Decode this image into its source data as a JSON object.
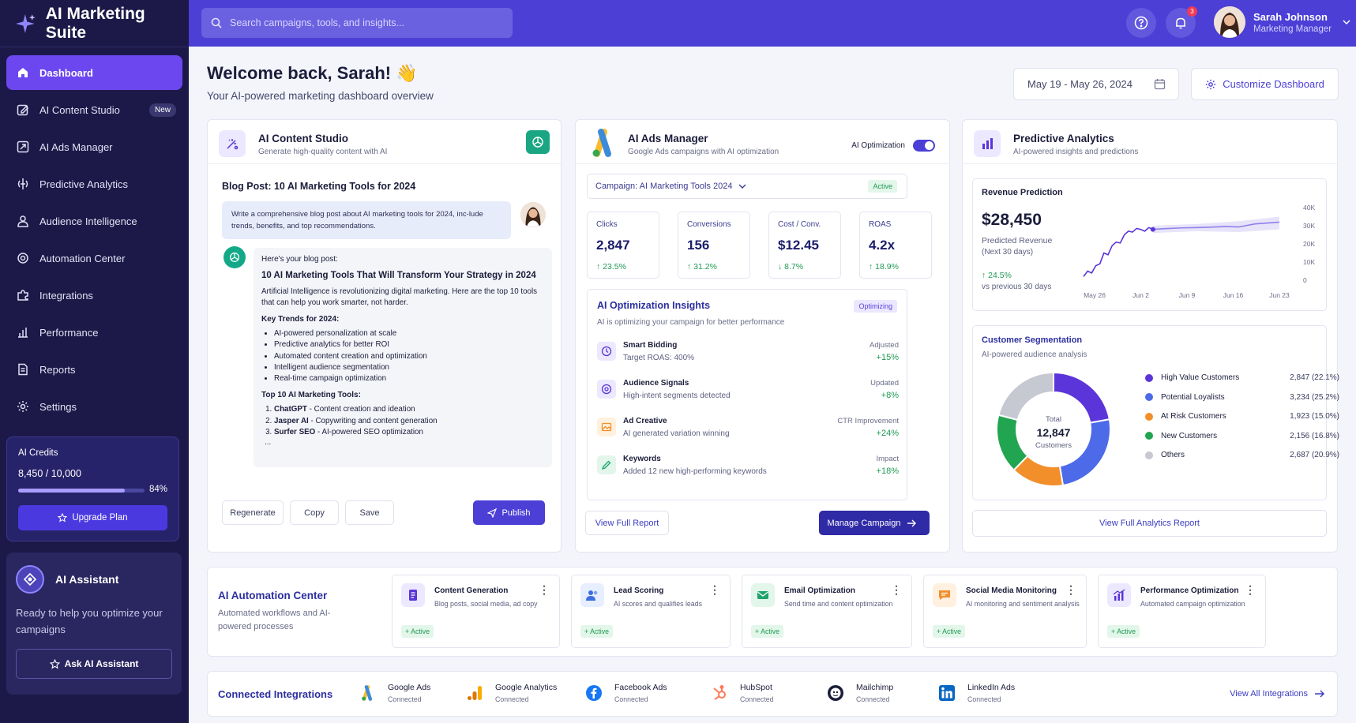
{
  "app": {
    "title": "AI Marketing Suite"
  },
  "sidebar": {
    "items": [
      {
        "label": "Dashboard",
        "icon": "home-icon",
        "active": true
      },
      {
        "label": "AI Content Studio",
        "icon": "edit-icon",
        "badge": "New"
      },
      {
        "label": "AI Ads Manager",
        "icon": "ads-icon"
      },
      {
        "label": "Predictive Analytics",
        "icon": "brain-icon"
      },
      {
        "label": "Audience Intelligence",
        "icon": "users-icon"
      },
      {
        "label": "Automation Center",
        "icon": "automation-icon"
      },
      {
        "label": "Integrations",
        "icon": "puzzle-icon"
      },
      {
        "label": "Performance",
        "icon": "bar-chart-icon"
      },
      {
        "label": "Reports",
        "icon": "document-icon"
      },
      {
        "label": "Settings",
        "icon": "gear-icon"
      }
    ],
    "credits": {
      "title": "AI Credits",
      "value": "8,450 / 10,000",
      "percent": "84%",
      "fraction": 0.845,
      "button": "Upgrade Plan"
    },
    "assistant": {
      "title": "AI Assistant",
      "desc": "Ready to help you optimize your campaigns",
      "button": "Ask AI Assistant"
    }
  },
  "topbar": {
    "search_placeholder": "Search campaigns, tools, and insights...",
    "notification_count": "3",
    "user": {
      "name": "Sarah Johnson",
      "role": "Marketing Manager"
    }
  },
  "header": {
    "welcome": "Welcome back, Sarah! 👋",
    "subtitle": "Your AI-powered marketing dashboard overview",
    "date_range": "May 19 - May 26, 2024",
    "customize": "Customize Dashboard"
  },
  "content_studio": {
    "title": "AI Content Studio",
    "subtitle": "Generate high-quality content with AI",
    "blog_title": "Blog Post: 10 AI Marketing Tools for 2024",
    "prompt": "Write a comprehensive blog post about AI marketing tools for 2024, inc-lude trends, benefits, and top recommendations.",
    "response_intro": "Here's your blog post:",
    "response_title": "10 AI Marketing Tools That Will Transform Your Strategy in 2024",
    "response_para": "Artificial Intelligence is revolutionizing digital marketing. Here are the top 10 tools that can help you work smarter, not harder.",
    "trends_heading": "Key Trends for 2024:",
    "trends": [
      "AI-powered personalization at scale",
      "Predictive analytics for better ROI",
      "Automated content creation and optimization",
      "Intelligent audience segmentation",
      "Real-time campaign optimization"
    ],
    "tools_heading": "Top 10 AI Marketing Tools:",
    "tools": [
      {
        "name": "ChatGPT",
        "desc": " - Content creation and ideation"
      },
      {
        "name": "Jasper AI",
        "desc": " - Copywriting and content generation"
      },
      {
        "name": "Surfer SEO",
        "desc": " - AI-powered SEO optimization"
      }
    ],
    "ellipsis": "...",
    "buttons": {
      "regenerate": "Regenerate",
      "copy": "Copy",
      "save": "Save",
      "publish": "Publish"
    }
  },
  "ads": {
    "title": "AI Ads Manager",
    "subtitle": "Google Ads campaigns with AI optimization",
    "toggle_label": "AI Optimization",
    "campaign": "Campaign: AI Marketing Tools 2024",
    "campaign_status": "Active",
    "metrics": [
      {
        "label": "Clicks",
        "value": "2,847",
        "change": "↑ 23.5%"
      },
      {
        "label": "Conversions",
        "value": "156",
        "change": "↑ 31.2%"
      },
      {
        "label": "Cost / Conv.",
        "value": "$12.45",
        "change": "↓ 8.7%"
      },
      {
        "label": "ROAS",
        "value": "4.2x",
        "change": "↑ 18.9%"
      }
    ],
    "insights_title": "AI Optimization Insights",
    "insights_badge": "Optimizing",
    "insights_sub": "AI is optimizing your campaign for better performance",
    "insights": [
      {
        "title": "Smart Bidding",
        "sub": "Target ROAS: 400%",
        "label": "Adjusted",
        "value": "+15%"
      },
      {
        "title": "Audience Signals",
        "sub": "High-intent segments detected",
        "label": "Updated",
        "value": "+8%"
      },
      {
        "title": "Ad Creative",
        "sub": "AI generated variation winning",
        "label": "CTR Improvement",
        "value": "+24%"
      },
      {
        "title": "Keywords",
        "sub": "Added 12 new high-performing keywords",
        "label": "Impact",
        "value": "+18%"
      }
    ],
    "view_report": "View Full Report",
    "manage": "Manage Campaign"
  },
  "analytics": {
    "title": "Predictive Analytics",
    "subtitle": "AI-powered insights and predictions",
    "revenue_title": "Revenue Prediction",
    "revenue_value": "$28,450",
    "revenue_label": "Predicted Revenue",
    "revenue_period": "(Next 30 days)",
    "revenue_change": "↑ 24.5%",
    "revenue_compare": "vs previous 30 days",
    "segmentation_title": "Customer Segmentation",
    "segmentation_sub": "AI-powered audience analysis",
    "total_label": "Total",
    "total_value": "12,847",
    "total_unit": "Customers",
    "view_report": "View Full Analytics Report"
  },
  "chart_data": [
    {
      "type": "line",
      "title": "Revenue Prediction",
      "x": [
        "May 26",
        "Jun 2",
        "Jun 9",
        "Jun 16",
        "Jun 23"
      ],
      "xticks": [
        "May 26",
        "Jun 2",
        "Jun 9",
        "Jun 16",
        "Jun 23"
      ],
      "yticks": [
        "0",
        "10K",
        "20K",
        "30K",
        "40K"
      ],
      "ylim": [
        0,
        40000
      ],
      "series": [
        {
          "name": "actual",
          "values": [
            [
              0,
              2000
            ],
            [
              1,
              5000
            ],
            [
              2,
              4000
            ],
            [
              3,
              8000
            ],
            [
              4,
              9000
            ],
            [
              5,
              15000
            ],
            [
              6,
              14000
            ],
            [
              7,
              19000
            ],
            [
              8,
              21000
            ],
            [
              9,
              20500
            ],
            [
              10,
              25000
            ],
            [
              11,
              27000
            ],
            [
              12,
              26500
            ],
            [
              13,
              28500
            ],
            [
              14,
              28000
            ],
            [
              15,
              27000
            ],
            [
              16,
              29000
            ],
            [
              17,
              28000
            ]
          ]
        },
        {
          "name": "forecast",
          "values": [
            [
              17,
              28000
            ],
            [
              20,
              28400
            ],
            [
              24,
              28800
            ],
            [
              28,
              29000
            ],
            [
              31,
              29200
            ],
            [
              35,
              29600
            ],
            [
              38,
              29300
            ],
            [
              42,
              31000
            ],
            [
              45,
              31500
            ],
            [
              48,
              32000
            ]
          ]
        }
      ],
      "band_upper": [
        [
          17,
          30000
        ],
        [
          28,
          31000
        ],
        [
          38,
          32500
        ],
        [
          48,
          35000
        ]
      ],
      "band_lower": [
        [
          17,
          26000
        ],
        [
          28,
          27000
        ],
        [
          38,
          26500
        ],
        [
          48,
          28000
        ]
      ],
      "xmax": 48
    },
    {
      "type": "pie",
      "title": "Customer Segmentation",
      "slices": [
        {
          "name": "High Value Customers",
          "value": 2847,
          "label": "2,847 (22.1%)",
          "color": "#5b35d9"
        },
        {
          "name": "Potential Loyalists",
          "value": 3234,
          "label": "3,234 (25.2%)",
          "color": "#4d6ae8"
        },
        {
          "name": "At Risk Customers",
          "value": 1923,
          "label": "1,923 (15.0%)",
          "color": "#f28f2a"
        },
        {
          "name": "New Customers",
          "value": 2156,
          "label": "2,156 (16.8%)",
          "color": "#22a550"
        },
        {
          "name": "Others",
          "value": 2687,
          "label": "2,687 (20.9%)",
          "color": "#c6c8d2"
        }
      ]
    }
  ],
  "automation": {
    "title": "AI Automation Center",
    "subtitle": "Automated workflows and AI-powered processes",
    "cards": [
      {
        "title": "Content Generation",
        "sub": "Blog posts, social media, ad copy",
        "status": "+ Active",
        "icon": "document-icon",
        "color": "#5b35d9",
        "bg": "#ece8ff"
      },
      {
        "title": "Lead Scoring",
        "sub": "AI scores and qualifies leads",
        "status": "+ Active",
        "icon": "users-icon",
        "color": "#3d6fe0",
        "bg": "#e6eeff"
      },
      {
        "title": "Email Optimization",
        "sub": "Send time and content optimization",
        "status": "+ Active",
        "icon": "mail-icon",
        "color": "#1fa36a",
        "bg": "#e2f6ec"
      },
      {
        "title": "Social Media Monitoring",
        "sub": "AI monitoring and sentiment analysis",
        "status": "+ Active",
        "icon": "chat-icon",
        "color": "#f28f2a",
        "bg": "#fff0e0"
      },
      {
        "title": "Performance Optimization",
        "sub": "Automated campaign optimization",
        "status": "+ Active",
        "icon": "bar-chart-icon",
        "color": "#5b35d9",
        "bg": "#ece8ff"
      }
    ]
  },
  "integrations": {
    "title": "Connected Integrations",
    "items": [
      {
        "name": "Google Ads",
        "status": "Connected",
        "icon": "google-ads-icon"
      },
      {
        "name": "Google Analytics",
        "status": "Connected",
        "icon": "google-analytics-icon"
      },
      {
        "name": "Facebook Ads",
        "status": "Connected",
        "icon": "facebook-icon"
      },
      {
        "name": "HubSpot",
        "status": "Connected",
        "icon": "hubspot-icon"
      },
      {
        "name": "Mailchimp",
        "status": "Connected",
        "icon": "mailchimp-icon"
      },
      {
        "name": "LinkedIn Ads",
        "status": "Connected",
        "icon": "linkedin-icon"
      }
    ],
    "view_all": "View All Integrations"
  }
}
